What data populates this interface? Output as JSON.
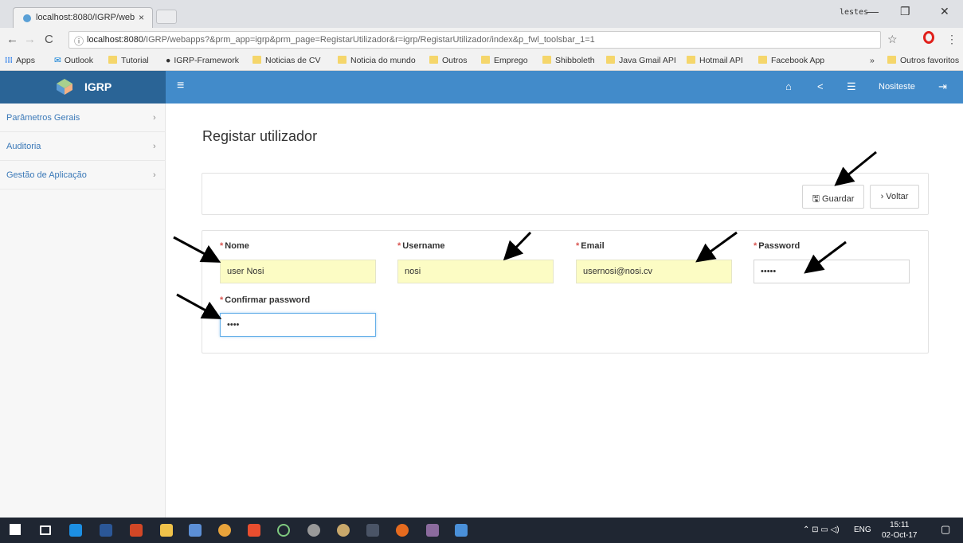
{
  "browser": {
    "tab_title": "localhost:8080/IGRP/web",
    "tab_close": "×",
    "window_label": "lestes",
    "url_prefix": "localhost:8080",
    "url_rest": "/IGRP/webapps?&prm_app=igrp&prm_page=RegistarUtilizador&r=igrp/RegistarUtilizador/index&p_fwl_toolsbar_1=1",
    "bookmarks": [
      "Apps",
      "Outlook",
      "Tutorial",
      "IGRP-Framework",
      "Noticias de CV",
      "Noticia do mundo",
      "Outros",
      "Emprego",
      "Shibboleth",
      "Java Gmail API",
      "Hotmail API",
      "Facebook App"
    ],
    "bookmarks_overflow": "»",
    "other_bookmarks": "Outros favoritos"
  },
  "app": {
    "brand": "IGRP",
    "user": "Nositeste"
  },
  "sidebar": {
    "items": [
      {
        "label": "Parâmetros Gerais"
      },
      {
        "label": "Auditoria"
      },
      {
        "label": "Gestão de Aplicação"
      }
    ]
  },
  "page": {
    "title": "Registar utilizador",
    "save_label": "Guardar",
    "back_label": "Voltar"
  },
  "form": {
    "required_mark": "*",
    "nome": {
      "label": "Nome",
      "value": "user Nosi"
    },
    "username": {
      "label": "Username",
      "value": "nosi"
    },
    "email": {
      "label": "Email",
      "value": "usernosi@nosi.cv"
    },
    "password": {
      "label": "Password",
      "value": "•••••"
    },
    "confirm": {
      "label": "Confirmar password",
      "value": "••••"
    }
  },
  "taskbar": {
    "lang": "ENG",
    "time": "15:11",
    "date": "02-Oct-17"
  },
  "colors": {
    "header": "#428bca",
    "brand": "#2a6496",
    "field_highlight": "#fcfcc4"
  }
}
